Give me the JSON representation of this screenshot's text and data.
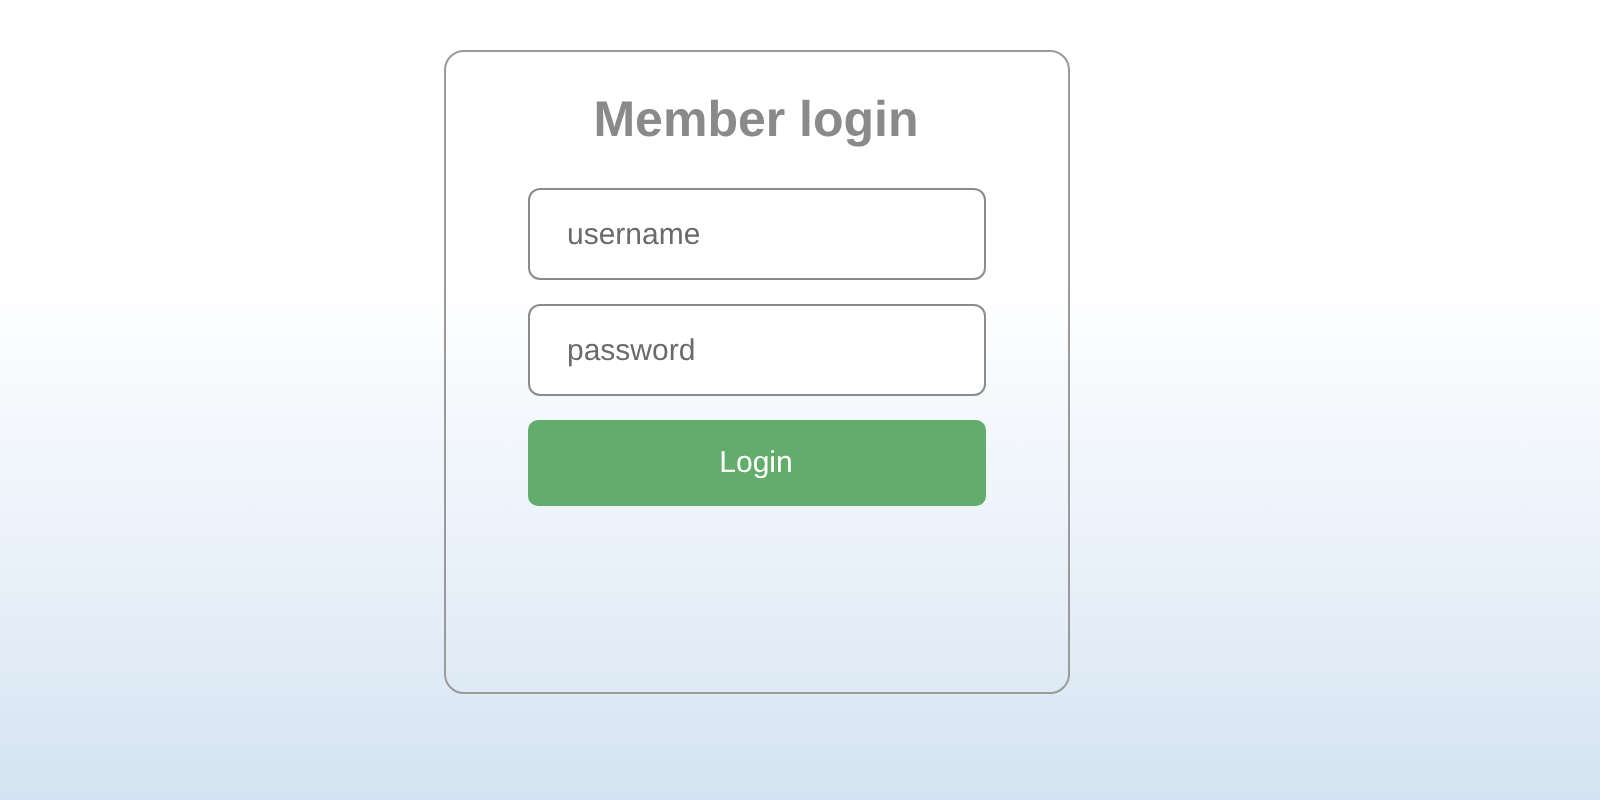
{
  "login_form": {
    "title": "Member login",
    "fields": [
      {
        "placeholder": "username"
      },
      {
        "placeholder": "password"
      }
    ],
    "button": "Login"
  }
}
